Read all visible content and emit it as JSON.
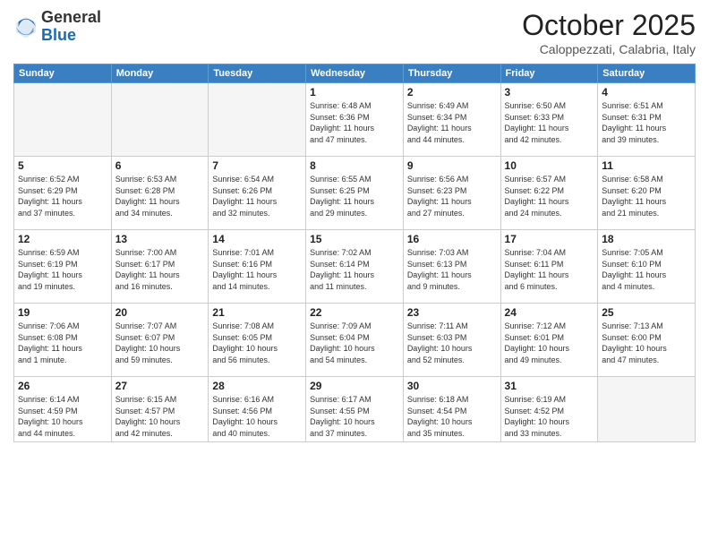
{
  "header": {
    "logo": {
      "general": "General",
      "blue": "Blue"
    },
    "title": "October 2025",
    "location": "Caloppezzati, Calabria, Italy"
  },
  "days_of_week": [
    "Sunday",
    "Monday",
    "Tuesday",
    "Wednesday",
    "Thursday",
    "Friday",
    "Saturday"
  ],
  "weeks": [
    [
      {
        "day": "",
        "info": ""
      },
      {
        "day": "",
        "info": ""
      },
      {
        "day": "",
        "info": ""
      },
      {
        "day": "1",
        "info": "Sunrise: 6:48 AM\nSunset: 6:36 PM\nDaylight: 11 hours\nand 47 minutes."
      },
      {
        "day": "2",
        "info": "Sunrise: 6:49 AM\nSunset: 6:34 PM\nDaylight: 11 hours\nand 44 minutes."
      },
      {
        "day": "3",
        "info": "Sunrise: 6:50 AM\nSunset: 6:33 PM\nDaylight: 11 hours\nand 42 minutes."
      },
      {
        "day": "4",
        "info": "Sunrise: 6:51 AM\nSunset: 6:31 PM\nDaylight: 11 hours\nand 39 minutes."
      }
    ],
    [
      {
        "day": "5",
        "info": "Sunrise: 6:52 AM\nSunset: 6:29 PM\nDaylight: 11 hours\nand 37 minutes."
      },
      {
        "day": "6",
        "info": "Sunrise: 6:53 AM\nSunset: 6:28 PM\nDaylight: 11 hours\nand 34 minutes."
      },
      {
        "day": "7",
        "info": "Sunrise: 6:54 AM\nSunset: 6:26 PM\nDaylight: 11 hours\nand 32 minutes."
      },
      {
        "day": "8",
        "info": "Sunrise: 6:55 AM\nSunset: 6:25 PM\nDaylight: 11 hours\nand 29 minutes."
      },
      {
        "day": "9",
        "info": "Sunrise: 6:56 AM\nSunset: 6:23 PM\nDaylight: 11 hours\nand 27 minutes."
      },
      {
        "day": "10",
        "info": "Sunrise: 6:57 AM\nSunset: 6:22 PM\nDaylight: 11 hours\nand 24 minutes."
      },
      {
        "day": "11",
        "info": "Sunrise: 6:58 AM\nSunset: 6:20 PM\nDaylight: 11 hours\nand 21 minutes."
      }
    ],
    [
      {
        "day": "12",
        "info": "Sunrise: 6:59 AM\nSunset: 6:19 PM\nDaylight: 11 hours\nand 19 minutes."
      },
      {
        "day": "13",
        "info": "Sunrise: 7:00 AM\nSunset: 6:17 PM\nDaylight: 11 hours\nand 16 minutes."
      },
      {
        "day": "14",
        "info": "Sunrise: 7:01 AM\nSunset: 6:16 PM\nDaylight: 11 hours\nand 14 minutes."
      },
      {
        "day": "15",
        "info": "Sunrise: 7:02 AM\nSunset: 6:14 PM\nDaylight: 11 hours\nand 11 minutes."
      },
      {
        "day": "16",
        "info": "Sunrise: 7:03 AM\nSunset: 6:13 PM\nDaylight: 11 hours\nand 9 minutes."
      },
      {
        "day": "17",
        "info": "Sunrise: 7:04 AM\nSunset: 6:11 PM\nDaylight: 11 hours\nand 6 minutes."
      },
      {
        "day": "18",
        "info": "Sunrise: 7:05 AM\nSunset: 6:10 PM\nDaylight: 11 hours\nand 4 minutes."
      }
    ],
    [
      {
        "day": "19",
        "info": "Sunrise: 7:06 AM\nSunset: 6:08 PM\nDaylight: 11 hours\nand 1 minute."
      },
      {
        "day": "20",
        "info": "Sunrise: 7:07 AM\nSunset: 6:07 PM\nDaylight: 10 hours\nand 59 minutes."
      },
      {
        "day": "21",
        "info": "Sunrise: 7:08 AM\nSunset: 6:05 PM\nDaylight: 10 hours\nand 56 minutes."
      },
      {
        "day": "22",
        "info": "Sunrise: 7:09 AM\nSunset: 6:04 PM\nDaylight: 10 hours\nand 54 minutes."
      },
      {
        "day": "23",
        "info": "Sunrise: 7:11 AM\nSunset: 6:03 PM\nDaylight: 10 hours\nand 52 minutes."
      },
      {
        "day": "24",
        "info": "Sunrise: 7:12 AM\nSunset: 6:01 PM\nDaylight: 10 hours\nand 49 minutes."
      },
      {
        "day": "25",
        "info": "Sunrise: 7:13 AM\nSunset: 6:00 PM\nDaylight: 10 hours\nand 47 minutes."
      }
    ],
    [
      {
        "day": "26",
        "info": "Sunrise: 6:14 AM\nSunset: 4:59 PM\nDaylight: 10 hours\nand 44 minutes."
      },
      {
        "day": "27",
        "info": "Sunrise: 6:15 AM\nSunset: 4:57 PM\nDaylight: 10 hours\nand 42 minutes."
      },
      {
        "day": "28",
        "info": "Sunrise: 6:16 AM\nSunset: 4:56 PM\nDaylight: 10 hours\nand 40 minutes."
      },
      {
        "day": "29",
        "info": "Sunrise: 6:17 AM\nSunset: 4:55 PM\nDaylight: 10 hours\nand 37 minutes."
      },
      {
        "day": "30",
        "info": "Sunrise: 6:18 AM\nSunset: 4:54 PM\nDaylight: 10 hours\nand 35 minutes."
      },
      {
        "day": "31",
        "info": "Sunrise: 6:19 AM\nSunset: 4:52 PM\nDaylight: 10 hours\nand 33 minutes."
      },
      {
        "day": "",
        "info": ""
      }
    ]
  ]
}
